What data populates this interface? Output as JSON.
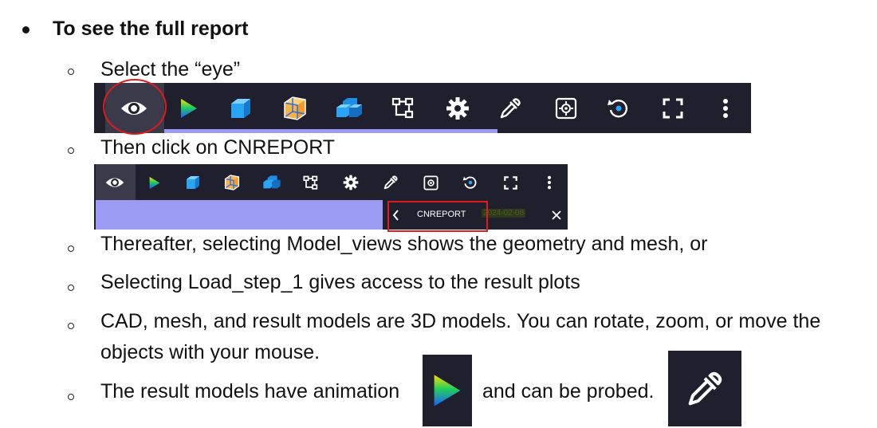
{
  "heading": "To see the full report",
  "items": [
    "Select the “eye”",
    "Then click on CNREPORT",
    "Thereafter, selecting Model_views shows the geometry and mesh, or",
    "Selecting Load_step_1 gives access to the result plots",
    "CAD, mesh, and result models are 3D models. You can rotate, zoom, or move the",
    "objects with your mouse.",
    "The result models have animation",
    "and can be probed."
  ],
  "toolbar_icons": [
    "eye-icon",
    "play-gradient-icon",
    "cube-solid-icon",
    "cube-wireframe-icon",
    "cubes-stack-icon",
    "tree-icon",
    "gear-icon",
    "eyedropper-icon",
    "fit-view-icon",
    "reset-rotate-icon",
    "fullscreen-icon",
    "more-vert-icon"
  ],
  "menu": {
    "item_label": "CNREPORT",
    "date_text": "2024-02-08"
  },
  "colors": {
    "toolbar_bg": "#1f1f2e",
    "accent_lavender": "#9b9bf3",
    "highlight_red": "#e01b1b"
  }
}
